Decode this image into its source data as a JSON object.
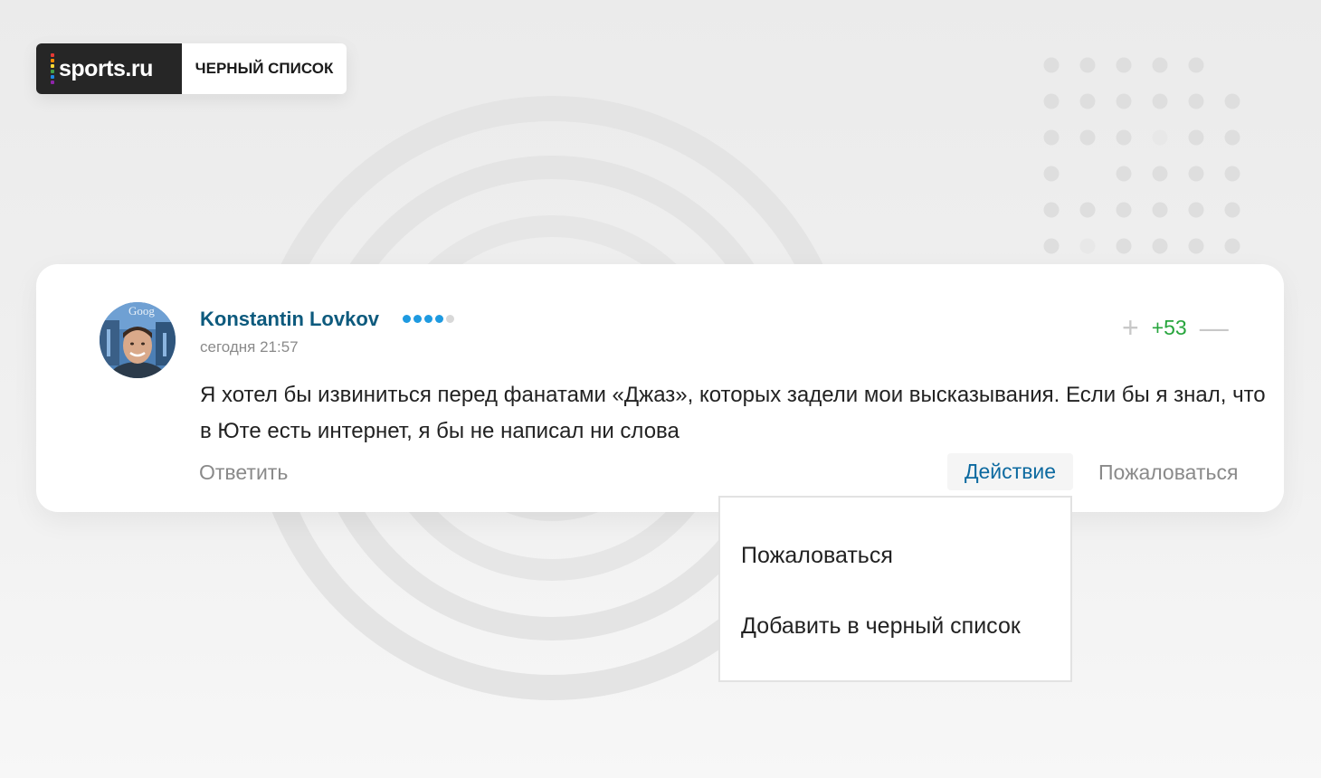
{
  "header": {
    "logo_text": "sports.ru",
    "logo_bar_colors": [
      "#e53935",
      "#fb8c00",
      "#fdd835",
      "#43a047",
      "#1e88e5",
      "#8e24aa"
    ],
    "label": "ЧЕРНЫЙ СПИСОК"
  },
  "comment": {
    "author": "Konstantin Lovkov",
    "rank_dots": {
      "filled": 4,
      "total": 5,
      "filled_color": "#1e9ae0",
      "empty_color": "#d8d8d8"
    },
    "timestamp": "сегодня 21:57",
    "avatar_sign_text": "Goog",
    "text": "Я хотел бы извиниться перед фанатами «Джаз», которых задели мои высказывания. Если бы я знал, что в Юте есть интернет, я бы не написал ни слова",
    "rating": "+53",
    "vote_plus": "+",
    "vote_minus": "—",
    "reply_label": "Ответить",
    "action_label": "Действие",
    "report_label": "Пожаловаться"
  },
  "dropdown": {
    "items": [
      {
        "label": "Пожаловаться"
      },
      {
        "label": "Добавить в черный список"
      }
    ]
  },
  "colors": {
    "author": "#0d5a7d",
    "rating": "#27a53d",
    "action": "#0d6aa0",
    "muted": "#8a8a8a"
  }
}
